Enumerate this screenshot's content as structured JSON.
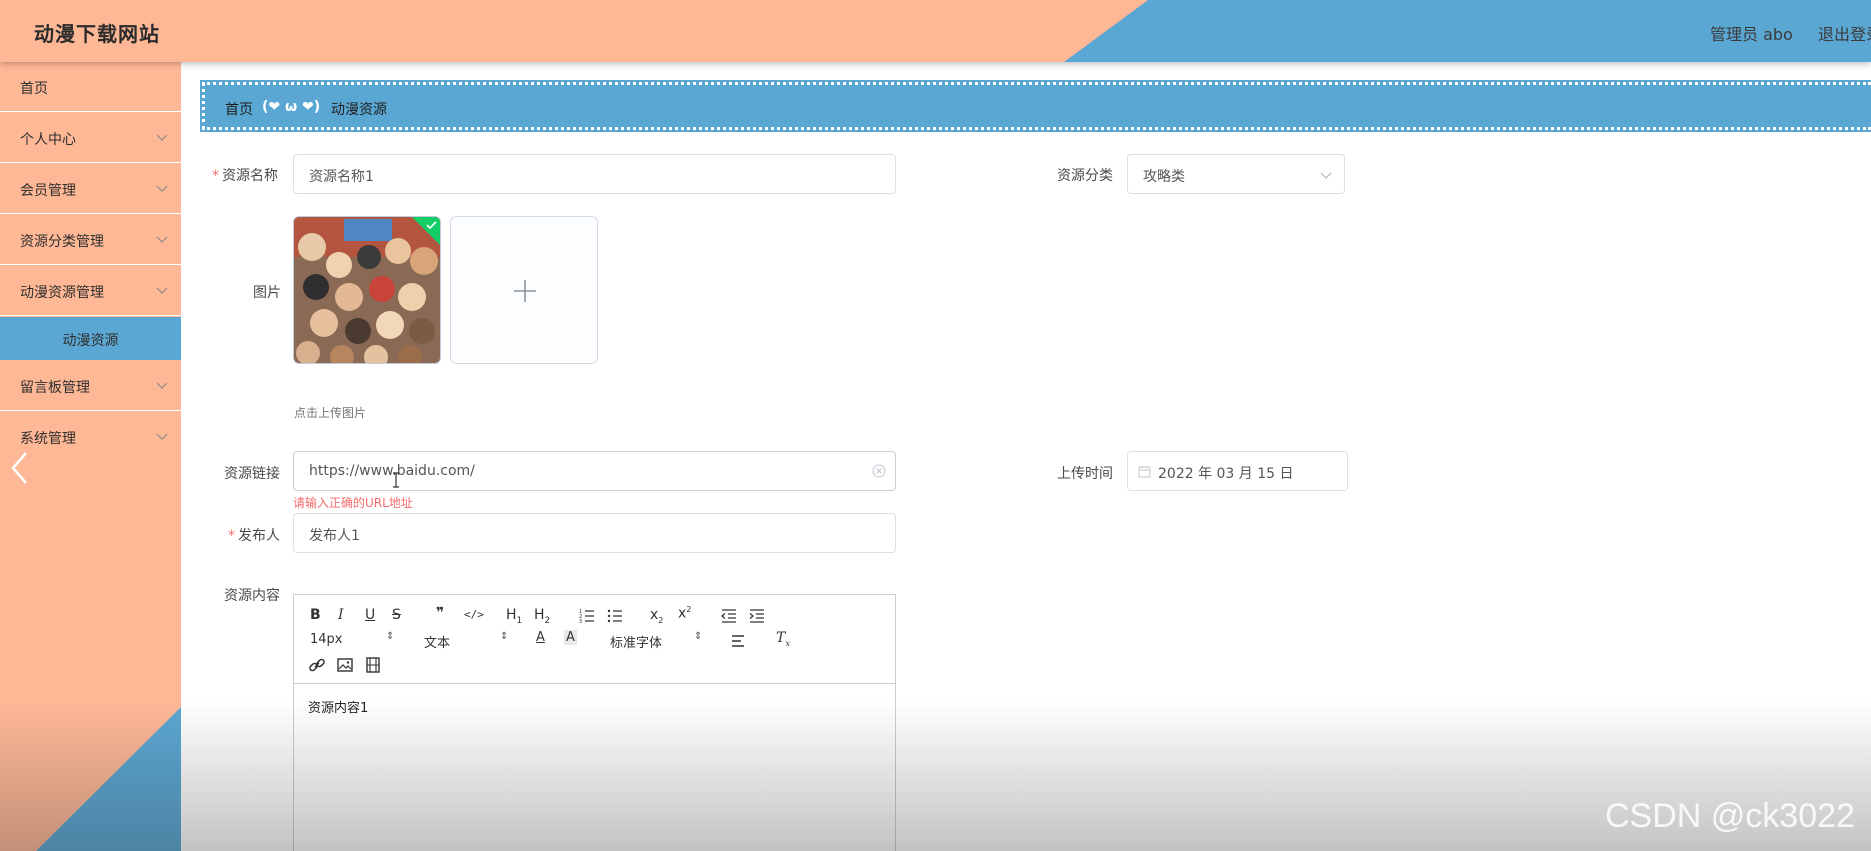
{
  "header": {
    "site_title": "动漫下载网站",
    "admin_label": "管理员 abo",
    "logout_label": "退出登录"
  },
  "sidebar": {
    "items": [
      {
        "label": "首页",
        "has_chevron": false
      },
      {
        "label": "个人中心",
        "has_chevron": true
      },
      {
        "label": "会员管理",
        "has_chevron": true
      },
      {
        "label": "资源分类管理",
        "has_chevron": true
      },
      {
        "label": "动漫资源管理",
        "has_chevron": true
      },
      {
        "label": "动漫资源",
        "active_sub": true
      },
      {
        "label": "留言板管理",
        "has_chevron": true
      },
      {
        "label": "系统管理",
        "has_chevron": true
      }
    ]
  },
  "breadcrumb": {
    "home": "首页",
    "separator": "(❤ ω ❤)",
    "current": "动漫资源"
  },
  "form": {
    "resource_name_label": "资源名称",
    "resource_name_value": "资源名称1",
    "category_label": "资源分类",
    "category_value": "攻略类",
    "image_label": "图片",
    "upload_hint": "点击上传图片",
    "link_label": "资源链接",
    "link_value": "https://www.baidu.com/",
    "link_error": "请输入正确的URL地址",
    "upload_time_label": "上传时间",
    "upload_time_value": "2022 年 03 月 15 日",
    "publisher_label": "发布人",
    "publisher_value": "发布人1",
    "content_label": "资源内容"
  },
  "editor": {
    "font_size": "14px",
    "text_style": "文本",
    "font_family": "标准字体",
    "content": "资源内容1"
  },
  "watermark": "CSDN @ck3022",
  "colors": {
    "peach": "#ffb896",
    "blue": "#5ba7d3",
    "error": "#f56c6c",
    "success": "#13ce66"
  }
}
